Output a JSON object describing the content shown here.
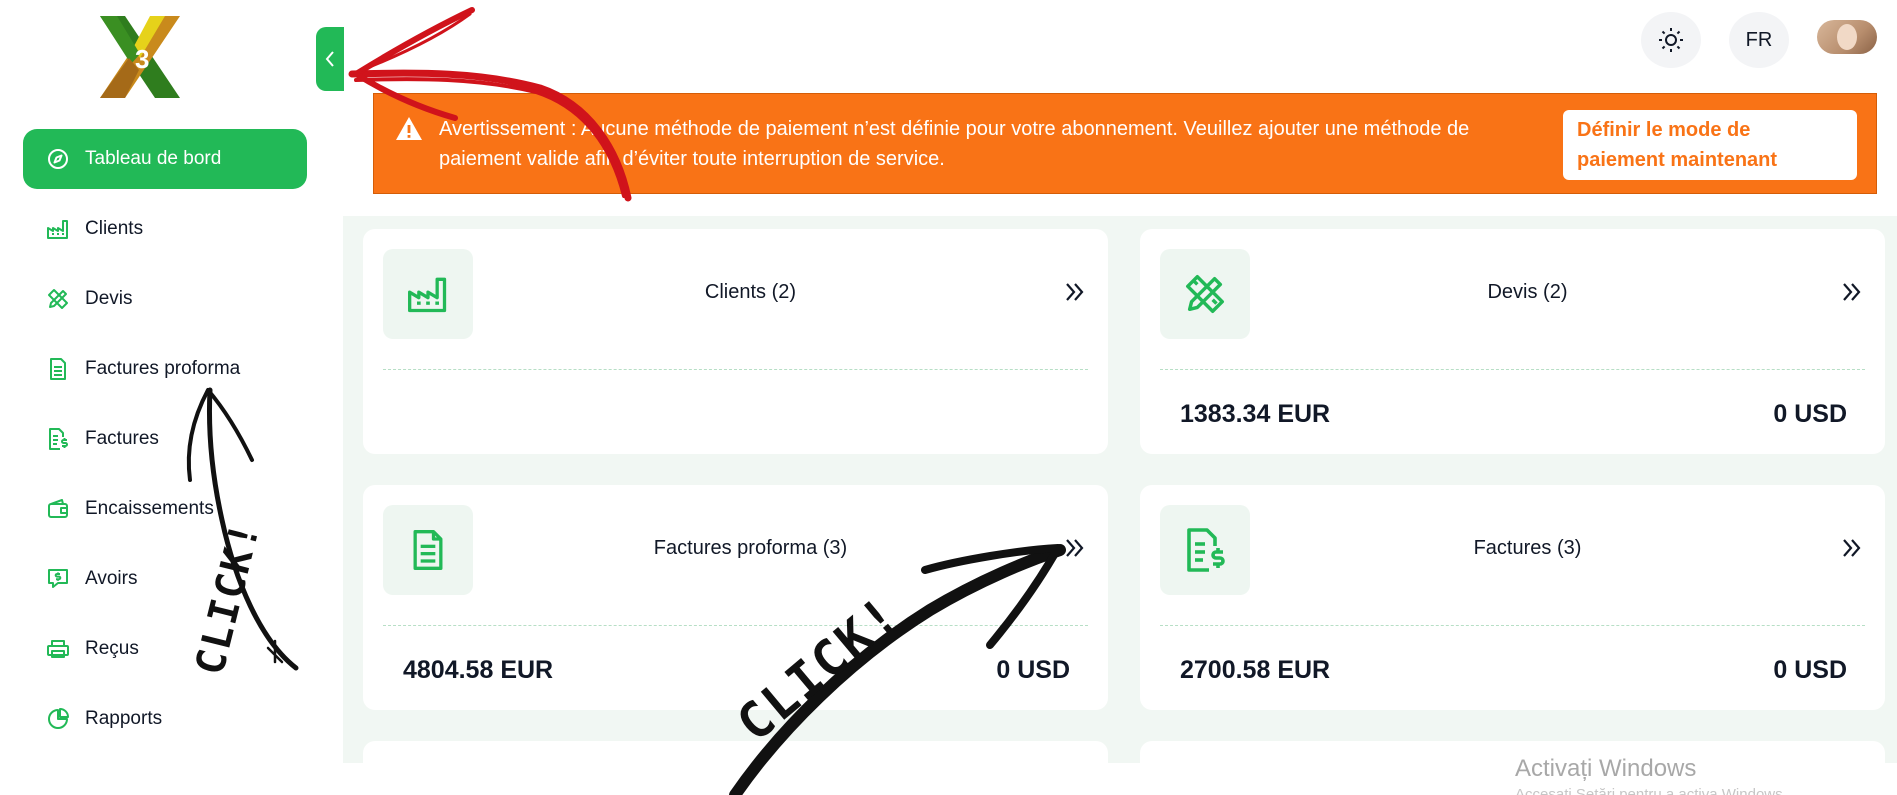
{
  "sidebar": {
    "items": [
      {
        "label": "Tableau de bord",
        "icon": "compass-icon",
        "active": true
      },
      {
        "label": "Clients",
        "icon": "factory-icon"
      },
      {
        "label": "Devis",
        "icon": "pencil-ruler-icon"
      },
      {
        "label": "Factures proforma",
        "icon": "document-icon"
      },
      {
        "label": "Factures",
        "icon": "invoice-dollar-icon"
      },
      {
        "label": "Encaissements",
        "icon": "wallet-icon"
      },
      {
        "label": "Avoirs",
        "icon": "chat-dollar-icon"
      },
      {
        "label": "Reçus",
        "icon": "printer-icon"
      },
      {
        "label": "Rapports",
        "icon": "pie-chart-icon"
      }
    ]
  },
  "topbar": {
    "language": "FR",
    "theme_icon": "sun-icon"
  },
  "banner": {
    "text": "Avertissement : Aucune méthode de paiement n’est définie pour votre abonnement. Veuillez ajouter une méthode de paiement valide afin d’éviter toute interruption de service.",
    "button_label": "Définir le mode de paiement maintenant",
    "color": "#f97316"
  },
  "cards": [
    {
      "title": "Clients (2)",
      "icon": "factory-icon",
      "amount_left": "",
      "amount_right": ""
    },
    {
      "title": "Devis (2)",
      "icon": "pencil-ruler-icon",
      "amount_left": "1383.34 EUR",
      "amount_right": "0 USD"
    },
    {
      "title": "Factures proforma (3)",
      "icon": "document-icon",
      "amount_left": "4804.58 EUR",
      "amount_right": "0 USD"
    },
    {
      "title": "Factures (3)",
      "icon": "invoice-dollar-icon",
      "amount_left": "2700.58 EUR",
      "amount_right": "0 USD"
    }
  ],
  "annotations": {
    "click_label": "CLICK!"
  },
  "watermark": {
    "title": "Activați Windows",
    "subtitle": "Accesați Setări pentru a activa Windows."
  },
  "colors": {
    "accent": "#22b957",
    "warning": "#f97316",
    "annotation_red": "#d0131b"
  }
}
